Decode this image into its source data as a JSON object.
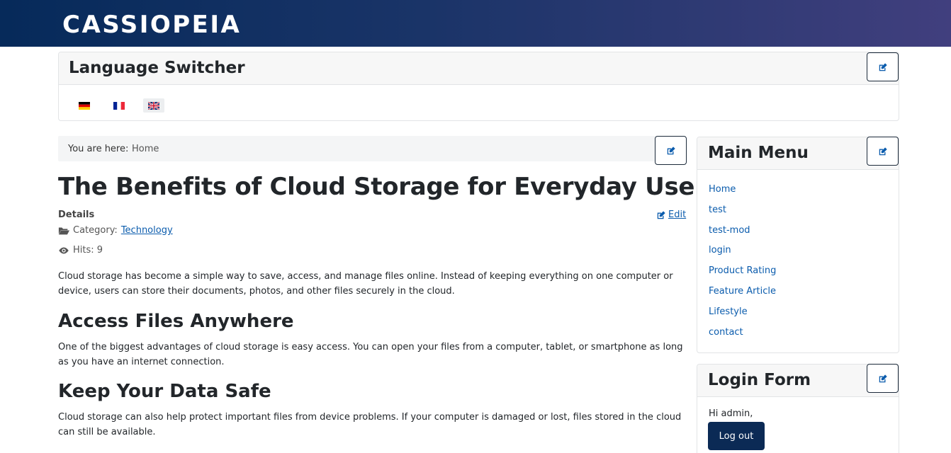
{
  "site": {
    "brand": "CASSIOPEIA"
  },
  "language_switcher": {
    "title": "Language Switcher",
    "languages": [
      {
        "code": "de",
        "flag": "german-flag",
        "active": false
      },
      {
        "code": "fr",
        "flag": "french-flag",
        "active": false
      },
      {
        "code": "en",
        "flag": "uk-flag",
        "active": true
      }
    ]
  },
  "breadcrumb": {
    "label": "You are here:",
    "home": "Home"
  },
  "article": {
    "title": "The Benefits of Cloud Storage for Everyday Users",
    "details_label": "Details",
    "edit_label": "Edit",
    "category_label": "Category:",
    "category": "Technology",
    "hits": "Hits: 9",
    "intro": "Cloud storage has become a simple way to save, access, and manage files online. Instead of keeping everything on one computer or device, users can store their documents, photos, and other files securely in the cloud.",
    "sections": [
      {
        "heading": "Access Files Anywhere",
        "text": "One of the biggest advantages of cloud storage is easy access. You can open your files from a computer, tablet, or smartphone as long as you have an internet connection."
      },
      {
        "heading": "Keep Your Data Safe",
        "text": "Cloud storage can also help protect important files from device problems. If your computer is damaged or lost, files stored in the cloud can still be available."
      }
    ]
  },
  "main_menu": {
    "title": "Main Menu",
    "items": [
      "Home",
      "test",
      "test-mod",
      "login",
      "Product Rating",
      "Feature Article",
      "Lifestyle",
      "contact"
    ]
  },
  "login_form": {
    "title": "Login Form",
    "greeting": "Hi admin,",
    "logout_label": "Log out"
  },
  "colors": {
    "link": "#0b5cad",
    "header_start": "#062a5a",
    "header_end": "#413f7e",
    "button": "#0b2a55"
  }
}
